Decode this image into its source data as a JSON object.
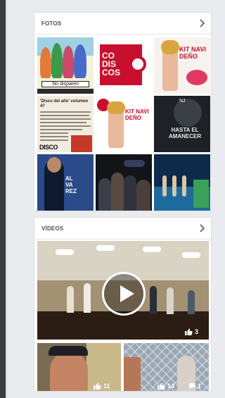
{
  "fotos": {
    "title": "FOTOS",
    "photos": [
      {
        "alt": "cartoon-illustration",
        "caption": "No disparen"
      },
      {
        "alt": "codiscos-logo",
        "text": "CO DIS COS"
      },
      {
        "alt": "kit-navideno-promo",
        "text": "KIT NAVI DEÑO"
      },
      {
        "alt": "newspaper-clipping",
        "headline": "'Disco del año' volumen 47",
        "footer": "DISCO"
      },
      {
        "alt": "kit-navideno-promo-2",
        "text": "KIT NAVI DEÑO"
      },
      {
        "alt": "album-cover-dark",
        "text": "HASTA EL AMANECER",
        "logo": "NJ"
      },
      {
        "alt": "alvarez-album",
        "text": "AL VA REZ"
      },
      {
        "alt": "group-photo-night"
      },
      {
        "alt": "stage-event"
      }
    ]
  },
  "videos": {
    "title": "VÍDEOS",
    "main": {
      "alt": "stage-video",
      "likes": "3"
    },
    "thumbs": [
      {
        "alt": "man-with-cap-video",
        "likes": "11"
      },
      {
        "alt": "fence-video",
        "likes": "14",
        "comments": "1"
      }
    ]
  },
  "colors": {
    "background": "#e9ebee",
    "card": "#ffffff",
    "accent_red": "#c8102e",
    "header_text": "#4b4f56"
  }
}
